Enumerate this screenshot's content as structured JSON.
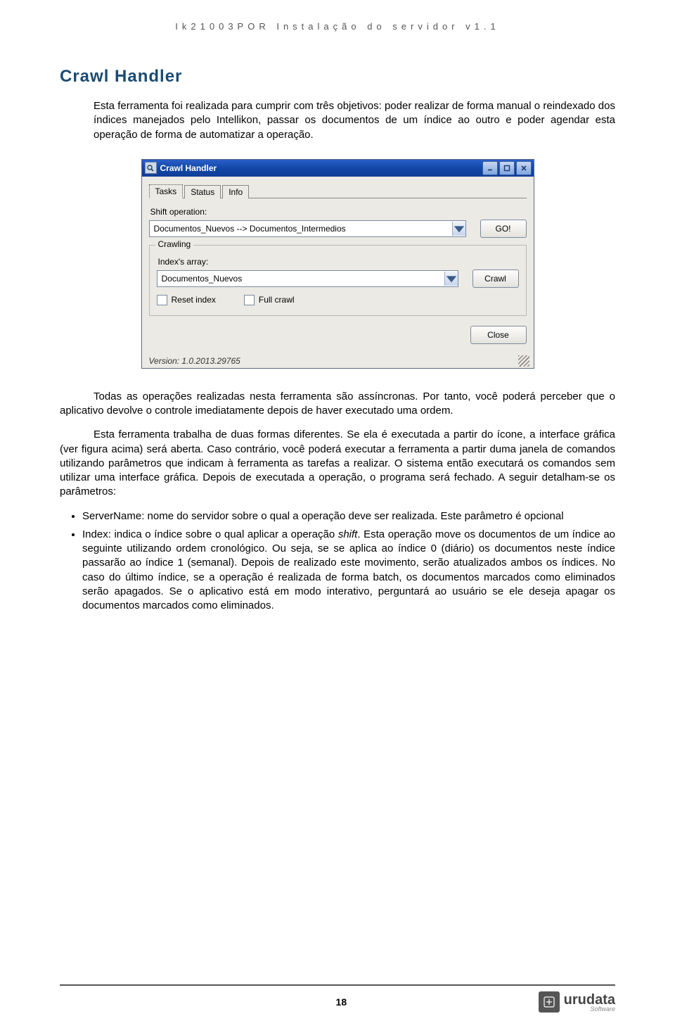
{
  "header": "Ik21003POR Instalação do servidor v1.1",
  "section_title": "Crawl Handler",
  "intro": "Esta ferramenta foi realizada para cumprir com três objetivos: poder realizar de forma manual o reindexado dos índices manejados pelo Intellikon, passar os documentos de um índice ao outro e poder agendar esta operação de forma de automatizar a operação.",
  "dlg": {
    "title": "Crawl Handler",
    "tabs": [
      "Tasks",
      "Status",
      "Info"
    ],
    "shift_label": "Shift operation:",
    "shift_value": "Documentos_Nuevos --> Documentos_Intermedios",
    "go_btn": "GO!",
    "crawl_section": "Crawling",
    "index_label": "Index's array:",
    "index_value": "Documentos_Nuevos",
    "crawl_btn": "Crawl",
    "reset_chk": "Reset index",
    "full_chk": "Full crawl",
    "close_btn": "Close",
    "version": "Version: 1.0.2013.29765"
  },
  "para1": "Todas as operações realizadas nesta ferramenta são assíncronas. Por tanto, você poderá perceber que o aplicativo devolve o controle imediatamente depois de haver executado uma ordem.",
  "para2": "Esta ferramenta trabalha de duas formas diferentes. Se ela é executada a partir do ícone, a interface gráfica (ver figura acima) será aberta. Caso contrário, você poderá executar a ferramenta a partir duma janela de comandos utilizando parâmetros que indicam à ferramenta as tarefas a realizar. O sistema então executará os comandos sem utilizar uma interface gráfica. Depois de executada a operação, o programa será fechado. A seguir detalham-se os parâmetros:",
  "param1": "ServerName: nome do servidor sobre o qual a operação deve ser realizada. Este parâmetro é opcional",
  "param2a": "Index: indica o índice sobre o qual aplicar a operação ",
  "param2_italic": "shift",
  "param2b": ". Esta operação move os documentos de um índice ao seguinte utilizando ordem cronológico. Ou seja, se se aplica ao índice 0 (diário) os documentos neste índice passarão ao índice 1 (semanal). Depois de realizado este movimento, serão atualizados ambos os índices. No caso do último índice, se a operação é realizada de forma batch, os documentos marcados como eliminados serão apagados. Se o aplicativo está em modo interativo, perguntará ao usuário se ele deseja apagar os documentos marcados como eliminados.",
  "page_num": "18",
  "logo_text": "urudata",
  "logo_sub": "Software"
}
